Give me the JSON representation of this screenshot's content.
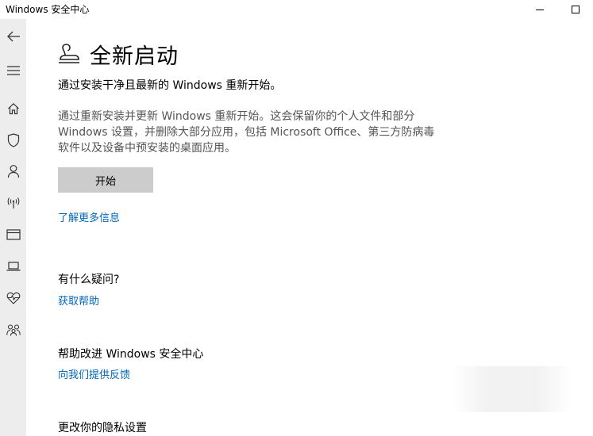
{
  "window": {
    "title": "Windows 安全中心"
  },
  "page": {
    "heading": "全新启动",
    "subtitle": "通过安装干净且最新的 Windows 重新开始。",
    "description": "通过重新安装并更新 Windows 重新开始。这会保留你的个人文件和部分 Windows 设置，并删除大部分应用，包括 Microsoft Office、第三方防病毒软件以及设备中预安装的桌面应用。",
    "start_button": "开始",
    "learn_more_link": "了解更多信息"
  },
  "help": {
    "heading": "有什么疑问?",
    "link": "获取帮助"
  },
  "improve": {
    "heading": "帮助改进 Windows 安全中心",
    "link": "向我们提供反馈"
  },
  "privacy": {
    "heading": "更改你的隐私设置"
  },
  "nav": {
    "icons": [
      "back-icon",
      "menu-icon",
      "home-icon",
      "shield-icon",
      "account-icon",
      "network-icon",
      "app-browser-icon",
      "device-security-icon",
      "device-health-icon",
      "family-icon"
    ]
  },
  "colors": {
    "link": "#0067b8",
    "rail_bg": "#ededed",
    "button_bg": "#cccccc"
  }
}
